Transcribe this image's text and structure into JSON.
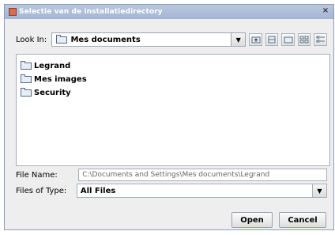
{
  "window": {
    "title": "Selectie van de installatiedirectory",
    "close": "×"
  },
  "lookin": {
    "label": "Look In:",
    "value": "Mes documents"
  },
  "files": [
    {
      "label": "Legrand"
    },
    {
      "label": "Mes images"
    },
    {
      "label": "Security"
    }
  ],
  "filename": {
    "label": "File Name:",
    "value": "C:\\Documents and Settings\\Mes documents\\Legrand"
  },
  "filetype": {
    "label": "Files of Type:",
    "value": "All Files"
  },
  "buttons": {
    "open": "Open",
    "cancel": "Cancel"
  }
}
